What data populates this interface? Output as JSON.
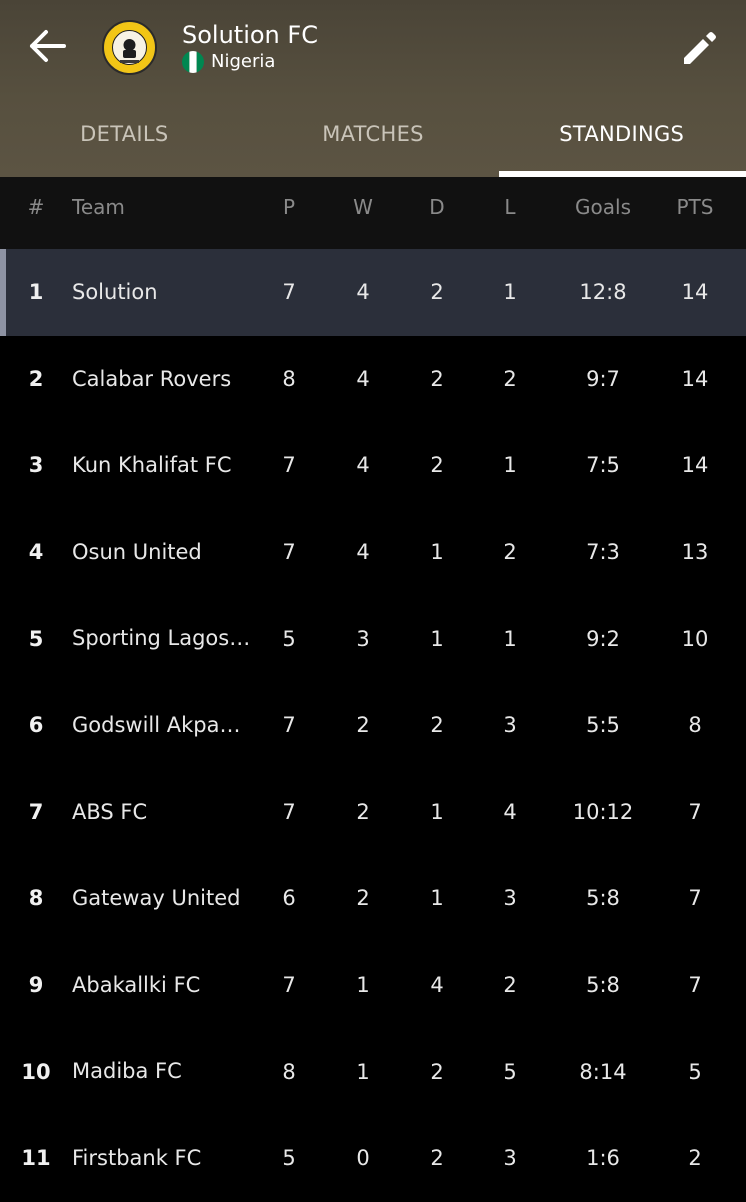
{
  "header": {
    "club_name": "Solution FC",
    "country": "Nigeria",
    "logo_icon": "club-crest-icon",
    "back_icon": "arrow-left-icon",
    "edit_icon": "pencil-icon",
    "colors": {
      "background": "#57503f",
      "accent": "#ffffff",
      "flag_green": "#008751"
    }
  },
  "tabs": [
    {
      "label": "DETAILS",
      "active": false
    },
    {
      "label": "MATCHES",
      "active": false
    },
    {
      "label": "STANDINGS",
      "active": true
    }
  ],
  "standings": {
    "columns": {
      "rank": "#",
      "team": "Team",
      "played": "P",
      "won": "W",
      "drawn": "D",
      "lost": "L",
      "goals": "Goals",
      "points": "PTS"
    },
    "rows": [
      {
        "rank": "1",
        "team": "Solution",
        "p": "7",
        "w": "4",
        "d": "2",
        "l": "1",
        "goals": "12:8",
        "pts": "14"
      },
      {
        "rank": "2",
        "team": "Calabar Rovers",
        "p": "8",
        "w": "4",
        "d": "2",
        "l": "2",
        "goals": "9:7",
        "pts": "14"
      },
      {
        "rank": "3",
        "team": "Kun Khalifat FC",
        "p": "7",
        "w": "4",
        "d": "2",
        "l": "1",
        "goals": "7:5",
        "pts": "14"
      },
      {
        "rank": "4",
        "team": "Osun United",
        "p": "7",
        "w": "4",
        "d": "1",
        "l": "2",
        "goals": "7:3",
        "pts": "13"
      },
      {
        "rank": "5",
        "team": "Sporting Lagos…",
        "p": "5",
        "w": "3",
        "d": "1",
        "l": "1",
        "goals": "9:2",
        "pts": "10"
      },
      {
        "rank": "6",
        "team": "Godswill Akpabi…",
        "p": "7",
        "w": "2",
        "d": "2",
        "l": "3",
        "goals": "5:5",
        "pts": "8"
      },
      {
        "rank": "7",
        "team": "ABS FC",
        "p": "7",
        "w": "2",
        "d": "1",
        "l": "4",
        "goals": "10:12",
        "pts": "7"
      },
      {
        "rank": "8",
        "team": "Gateway United",
        "p": "6",
        "w": "2",
        "d": "1",
        "l": "3",
        "goals": "5:8",
        "pts": "7"
      },
      {
        "rank": "9",
        "team": "Abakallki FC",
        "p": "7",
        "w": "1",
        "d": "4",
        "l": "2",
        "goals": "5:8",
        "pts": "7"
      },
      {
        "rank": "10",
        "team": "Madiba FC",
        "p": "8",
        "w": "1",
        "d": "2",
        "l": "5",
        "goals": "8:14",
        "pts": "5"
      },
      {
        "rank": "11",
        "team": "Firstbank FC",
        "p": "5",
        "w": "0",
        "d": "2",
        "l": "3",
        "goals": "1:6",
        "pts": "2"
      }
    ]
  }
}
